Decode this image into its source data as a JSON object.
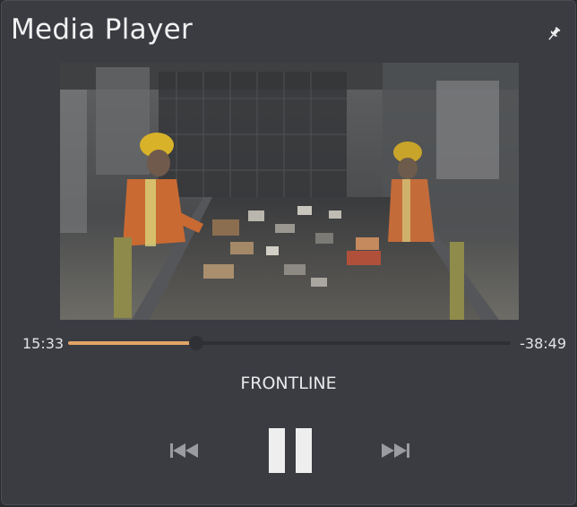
{
  "window": {
    "title": "Media Player"
  },
  "video": {
    "description": "Workers in hard hats and orange safety vests sorting items on a conveyor belt"
  },
  "playback": {
    "elapsed": "15:33",
    "remaining": "-38:49",
    "progress_fraction": 0.29,
    "state": "playing"
  },
  "track": {
    "title": "FRONTLINE"
  },
  "controls": {
    "prev_icon": "skip-previous-icon",
    "pause_icon": "pause-icon",
    "next_icon": "skip-next-icon",
    "pin_icon": "pin-icon"
  },
  "colors": {
    "accent": "#e2a466",
    "panel": "#3a3c42",
    "text": "#e9e9ea"
  }
}
